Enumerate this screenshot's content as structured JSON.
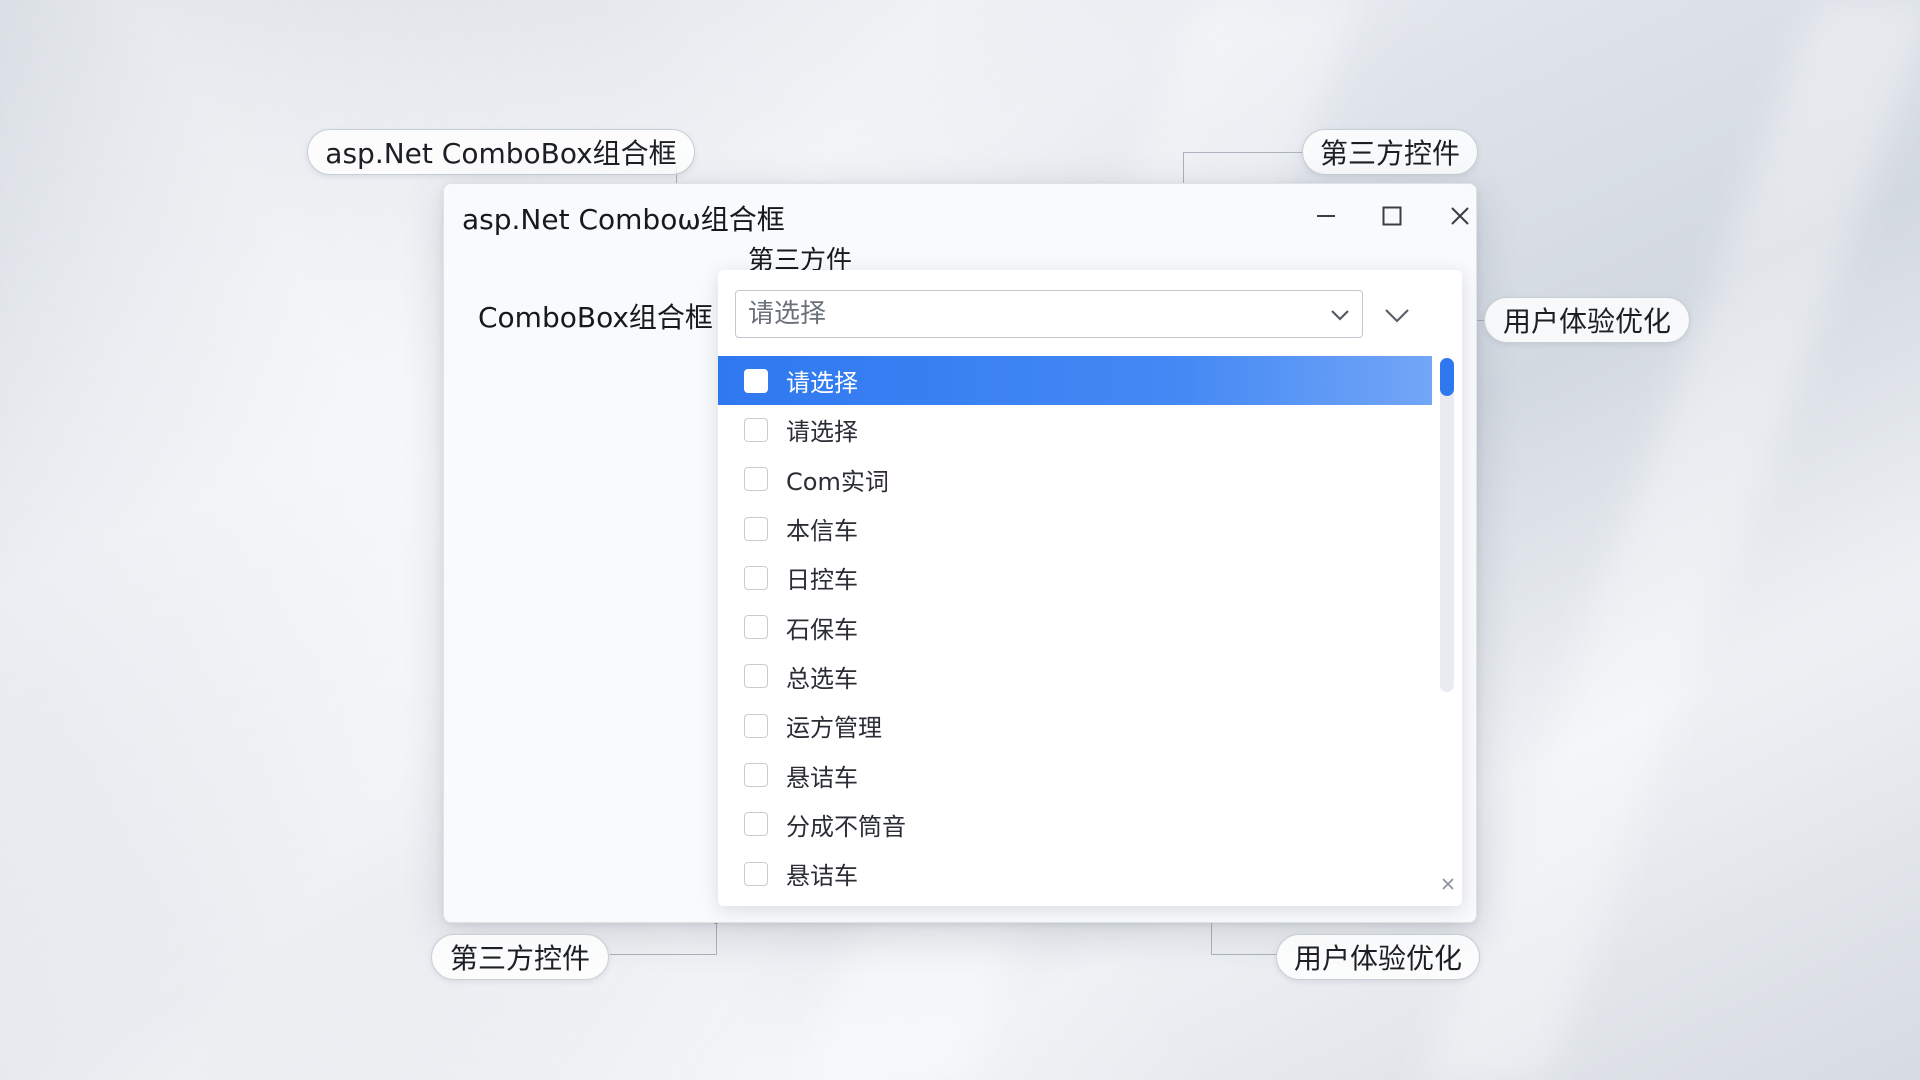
{
  "callouts": {
    "top_left": "asp.Net  ComboBox组合框",
    "top_right": "第三方控件",
    "right_mid": "用户体验优化",
    "bottom_left": "第三方控件",
    "bottom_right": "用户体验优化"
  },
  "window": {
    "title": "asp.Net Comboω组合框",
    "subtitle": "第三方件",
    "field_label": "ComboBox组合框"
  },
  "combo": {
    "placeholder": "请选择",
    "items": [
      {
        "label": "请选择",
        "selected": true
      },
      {
        "label": "请选择",
        "selected": false
      },
      {
        "label": "Com实词",
        "selected": false
      },
      {
        "label": "本信车",
        "selected": false
      },
      {
        "label": "日控车",
        "selected": false
      },
      {
        "label": "石保车",
        "selected": false
      },
      {
        "label": "总选车",
        "selected": false
      },
      {
        "label": "运方管理",
        "selected": false
      },
      {
        "label": "悬诘车",
        "selected": false
      },
      {
        "label": "分成不筒音",
        "selected": false
      },
      {
        "label": "悬诘车",
        "selected": false
      }
    ]
  },
  "colors": {
    "accent": "#2f78f0",
    "connector": "#aab2bd"
  },
  "icons": {
    "minimize": "minimize-icon",
    "maximize": "maximize-icon",
    "close": "close-icon",
    "caret": "chevron-down-icon"
  }
}
